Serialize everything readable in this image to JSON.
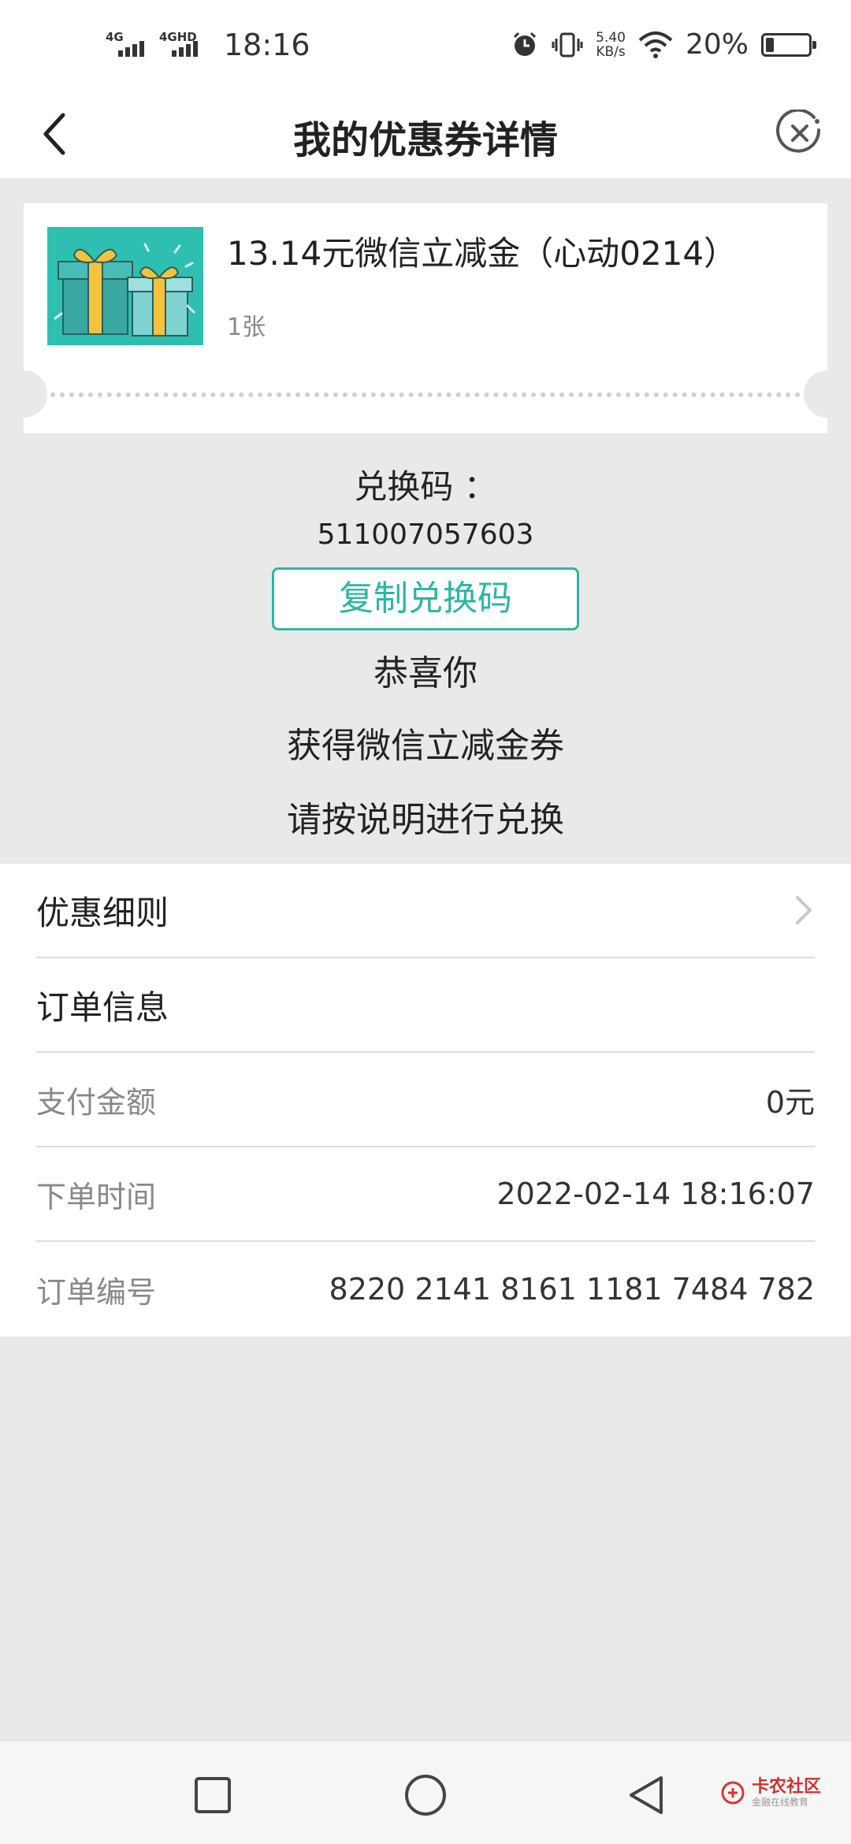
{
  "status_bar": {
    "network1": "4G",
    "network2": "4GHD",
    "time": "18:16",
    "speed_value": "5.40",
    "speed_unit": "KB/s",
    "battery": "20%",
    "battery_level": 0.2
  },
  "header": {
    "title": "我的优惠券详情"
  },
  "coupon": {
    "name": "13.14元微信立减金（心动0214）",
    "count": "1张",
    "image_icon": "gift-boxes"
  },
  "redeem": {
    "label": "兑换码 ：",
    "code": "511007057603",
    "copy_button": "复制兑换码",
    "message_1": "恭喜你",
    "message_2": "获得微信立减金券",
    "message_3": "请按说明进行兑换"
  },
  "details": {
    "rules_label": "优惠细则",
    "order_info_label": "订单信息",
    "rows": [
      {
        "key": "支付金额",
        "value": "0元"
      },
      {
        "key": "下单时间",
        "value": "2022-02-14 18:16:07"
      },
      {
        "key": "订单编号",
        "value": "8220 2141 8161 1181 7484 782"
      }
    ]
  },
  "watermark": {
    "title": "卡农社区",
    "subtitle": "金融在线教育"
  },
  "colors": {
    "accent": "#2db5a6",
    "background": "#e9e9e9"
  }
}
